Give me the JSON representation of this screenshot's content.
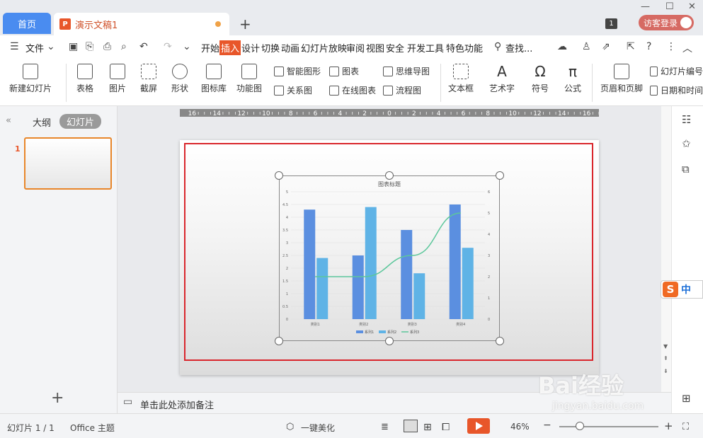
{
  "titlebar": {
    "home_tab": "首页",
    "doc_tab": "演示文稿1",
    "doc_icon": "P",
    "add_tab": "+",
    "badge": "1",
    "login": "访客登录"
  },
  "menubar": {
    "file": "文件",
    "items": [
      "开始",
      "插入",
      "设计",
      "切换",
      "动画",
      "幻灯片放映",
      "审阅",
      "视图",
      "安全",
      "开发工具",
      "特色功能"
    ],
    "active": "插入",
    "search": "查找..."
  },
  "ribbon": {
    "large": [
      "新建幻灯片",
      "表格",
      "图片",
      "截屏",
      "形状",
      "图标库",
      "功能图",
      "文本框",
      "艺术字",
      "符号",
      "公式",
      "页眉和页脚"
    ],
    "small": [
      "智能图形",
      "图表",
      "思维导图",
      "关系图",
      "在线图表",
      "流程图",
      "幻灯片编号",
      "日期和时间"
    ]
  },
  "leftpane": {
    "tab_outline": "大纲",
    "tab_slides": "幻灯片",
    "slide_number": "1",
    "add": "+"
  },
  "ruler": {
    "labels": [
      "16",
      "14",
      "12",
      "10",
      "8",
      "6",
      "4",
      "2",
      "0",
      "2",
      "4",
      "6",
      "8",
      "10",
      "12",
      "14",
      "16"
    ]
  },
  "notes": {
    "placeholder": "单击此处添加备注"
  },
  "status": {
    "slide": "幻灯片 1 / 1",
    "theme": "Office 主题",
    "beautify": "一键美化",
    "zoom": "46%"
  },
  "overlay": {
    "ime_s": "S",
    "ime_zh": "中",
    "watermark": "Bai经验",
    "watermark_sub": "jingyan.baidu.com"
  },
  "chart_data": {
    "type": "bar",
    "title": "图表标题",
    "categories": [
      "类别1",
      "类别2",
      "类别3",
      "类别4"
    ],
    "ylim": [
      0,
      5
    ],
    "yticks": [
      "5",
      "4.5",
      "4",
      "3.5",
      "3",
      "2.5",
      "2",
      "1.5",
      "1",
      "0.5",
      "0"
    ],
    "y2lim": [
      0,
      6
    ],
    "y2ticks": [
      "6",
      "5",
      "4",
      "3",
      "2",
      "1",
      "0"
    ],
    "series": [
      {
        "name": "系列1",
        "values": [
          4.3,
          2.5,
          3.5,
          4.5
        ],
        "color": "#5b8fe0",
        "kind": "bar"
      },
      {
        "name": "系列2",
        "values": [
          2.4,
          4.4,
          1.8,
          2.8
        ],
        "color": "#5fb3e6",
        "kind": "bar"
      },
      {
        "name": "系列3",
        "values": [
          2,
          2,
          3,
          5
        ],
        "color": "#5cc79b",
        "kind": "line"
      }
    ],
    "grid": true,
    "legend": "bottom"
  }
}
